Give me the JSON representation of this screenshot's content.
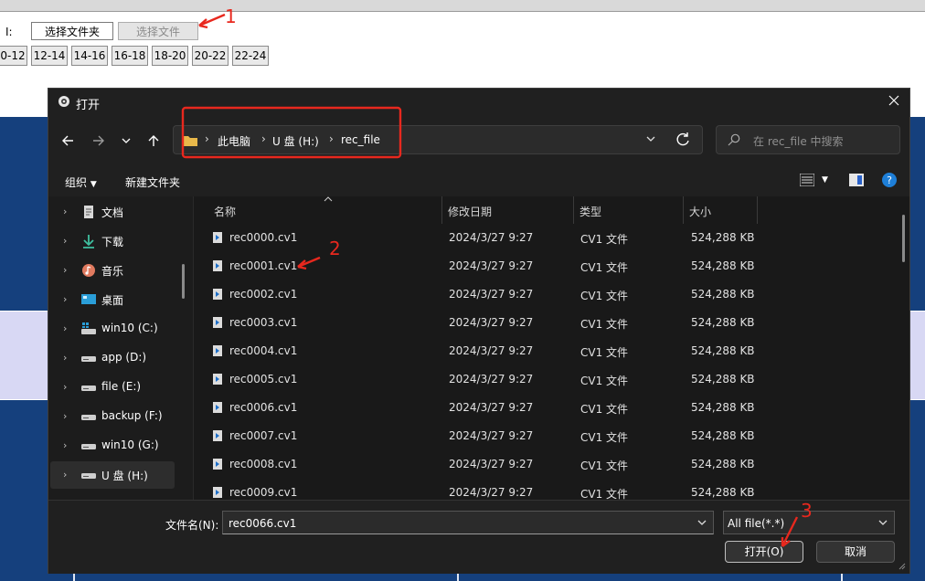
{
  "background": {
    "label": "I:",
    "btn_select_folder": "选择文件夹",
    "btn_select_file": "选择文件",
    "hour_buttons": [
      "0-12",
      "12-14",
      "14-16",
      "16-18",
      "18-20",
      "20-22",
      "22-24"
    ]
  },
  "annotations": [
    "1",
    "2",
    "3"
  ],
  "dialog": {
    "title": "打开",
    "breadcrumb": [
      "此电脑",
      "U 盘 (H:)",
      "rec_file"
    ],
    "search_placeholder": "在 rec_file 中搜索",
    "organize_label": "组织",
    "new_folder_label": "新建文件夹",
    "nav_items": [
      {
        "label": "文档",
        "icon": "document-icon"
      },
      {
        "label": "下载",
        "icon": "download-icon"
      },
      {
        "label": "音乐",
        "icon": "music-icon"
      },
      {
        "label": "桌面",
        "icon": "desktop-icon"
      },
      {
        "label": "win10 (C:)",
        "icon": "system-drive-icon"
      },
      {
        "label": "app (D:)",
        "icon": "drive-icon"
      },
      {
        "label": "file (E:)",
        "icon": "drive-icon"
      },
      {
        "label": "backup (F:)",
        "icon": "drive-icon"
      },
      {
        "label": "win10 (G:)",
        "icon": "drive-icon"
      },
      {
        "label": "U 盘 (H:)",
        "icon": "drive-icon"
      }
    ],
    "columns": [
      "名称",
      "修改日期",
      "类型",
      "大小"
    ],
    "files": [
      {
        "name": "rec0000.cv1",
        "date": "2024/3/27 9:27",
        "type": "CV1 文件",
        "size": "524,288 KB"
      },
      {
        "name": "rec0001.cv1",
        "date": "2024/3/27 9:27",
        "type": "CV1 文件",
        "size": "524,288 KB"
      },
      {
        "name": "rec0002.cv1",
        "date": "2024/3/27 9:27",
        "type": "CV1 文件",
        "size": "524,288 KB"
      },
      {
        "name": "rec0003.cv1",
        "date": "2024/3/27 9:27",
        "type": "CV1 文件",
        "size": "524,288 KB"
      },
      {
        "name": "rec0004.cv1",
        "date": "2024/3/27 9:27",
        "type": "CV1 文件",
        "size": "524,288 KB"
      },
      {
        "name": "rec0005.cv1",
        "date": "2024/3/27 9:27",
        "type": "CV1 文件",
        "size": "524,288 KB"
      },
      {
        "name": "rec0006.cv1",
        "date": "2024/3/27 9:27",
        "type": "CV1 文件",
        "size": "524,288 KB"
      },
      {
        "name": "rec0007.cv1",
        "date": "2024/3/27 9:27",
        "type": "CV1 文件",
        "size": "524,288 KB"
      },
      {
        "name": "rec0008.cv1",
        "date": "2024/3/27 9:27",
        "type": "CV1 文件",
        "size": "524,288 KB"
      },
      {
        "name": "rec0009.cv1",
        "date": "2024/3/27 9:27",
        "type": "CV1 文件",
        "size": "524,288 KB"
      }
    ],
    "filename_label": "文件名(N):",
    "filename_value": "rec0066.cv1",
    "filetype_value": "All file(*.*)",
    "open_button": "打开(O)",
    "cancel_button": "取消"
  },
  "colors": {
    "annotation": "#e8281e",
    "dialog_bg": "#202020",
    "background_panel": "#15407d"
  }
}
